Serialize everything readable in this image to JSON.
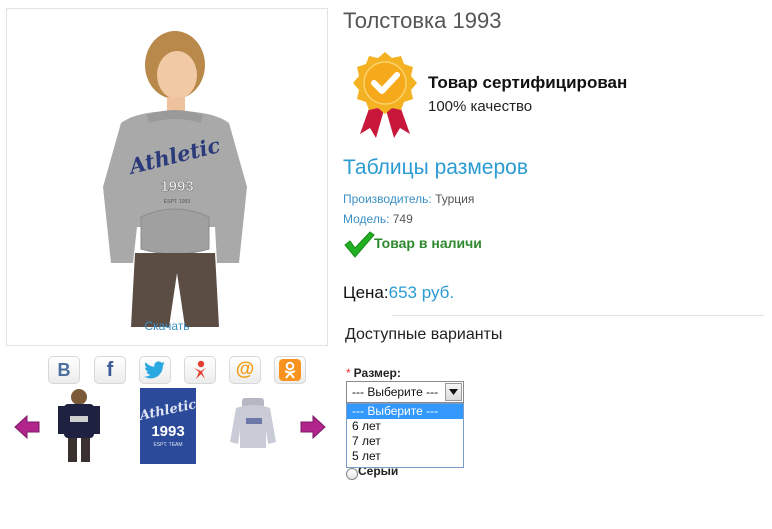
{
  "product": {
    "title": "Толстовка 1993",
    "download_label": "Скачать",
    "print_text": "Athletic",
    "print_number": "1993",
    "print_small": "ESPT. 1993"
  },
  "share": [
    {
      "name": "vk",
      "glyph": "B",
      "color": "#4a6f9c"
    },
    {
      "name": "facebook",
      "glyph": "f",
      "color": "#3b5998"
    },
    {
      "name": "twitter",
      "glyph": "twitter-bird",
      "color": "#2aa9e0"
    },
    {
      "name": "moimir",
      "glyph": "@",
      "color": "#f39c12"
    }
  ],
  "certificate": {
    "title": "Товар сертифицирован",
    "subtitle": "100% качество"
  },
  "size_tables_link": "Таблицы размеров",
  "manufacturer": {
    "label": "Производитель:",
    "value": "Турция"
  },
  "model": {
    "label": "Модель:",
    "value": "749"
  },
  "stock": "Товар в наличи",
  "price": {
    "label": "Цена:",
    "value": "653 руб."
  },
  "variants": {
    "title": "Доступные варианты",
    "size_label": "Размер:",
    "required_mark": "*",
    "select_value": "--- Выберите ---",
    "options": [
      "--- Выберите ---",
      "6 лет",
      "7 лет",
      "5 лет"
    ],
    "color_label": "Серый"
  }
}
